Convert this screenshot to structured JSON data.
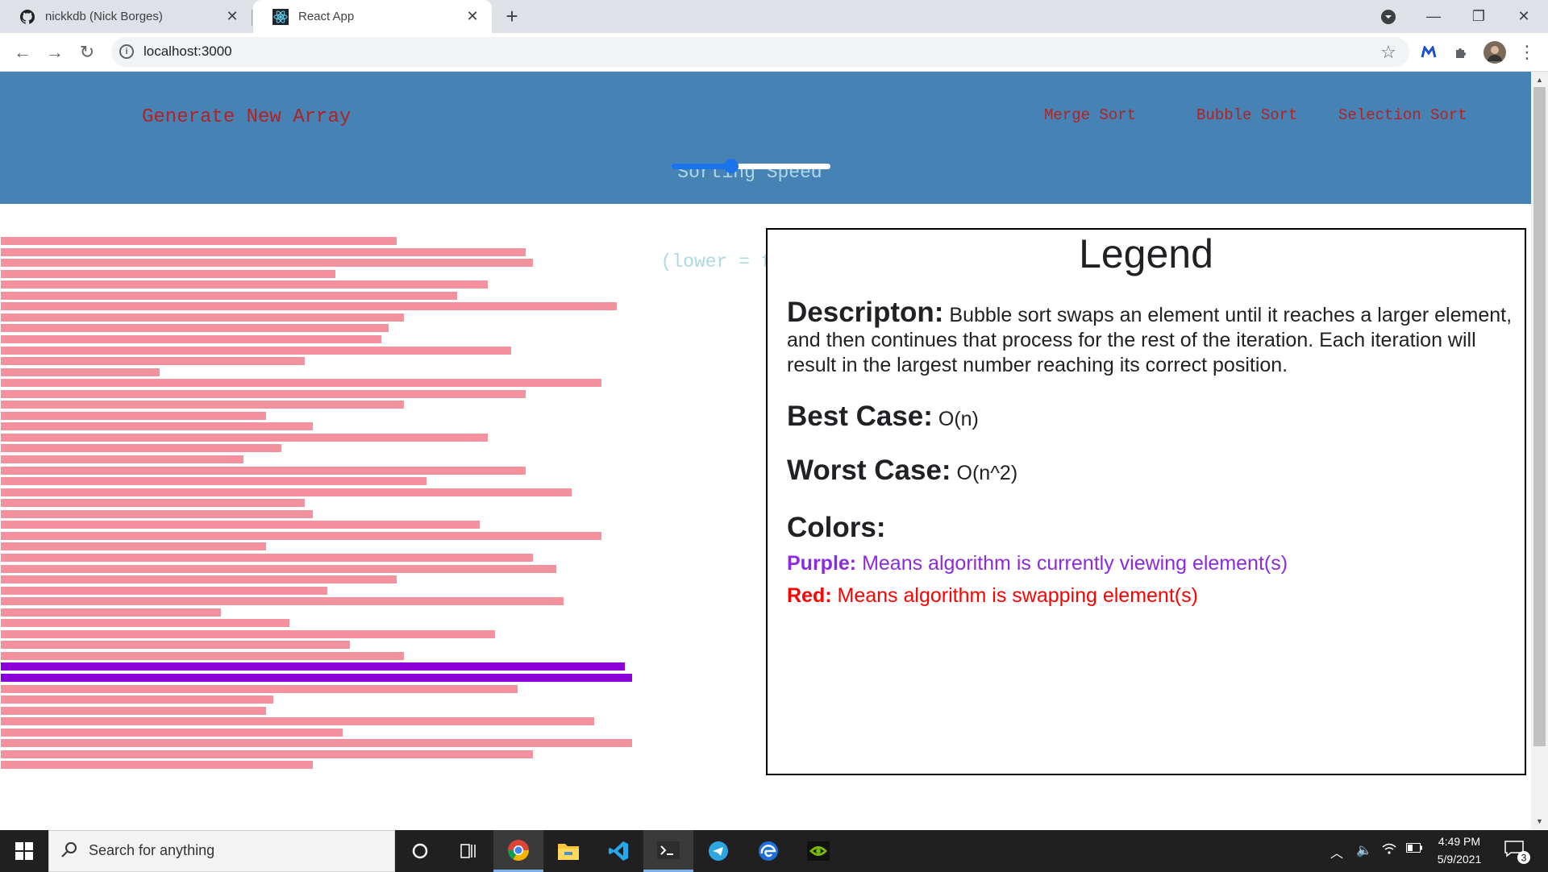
{
  "browser": {
    "tabs": [
      {
        "title": "nickkdb (Nick Borges)",
        "icon": "github-icon"
      },
      {
        "title": "React App",
        "icon": "react-icon",
        "active": true
      }
    ],
    "url": "localhost:3000"
  },
  "header": {
    "generate_label": "Generate New Array",
    "speed_title_1": "Sorting Speed",
    "speed_title_2": "(lower = faster)",
    "speed_value": 0.38,
    "algorithms": [
      "Merge Sort",
      "Bubble Sort",
      "Selection Sort"
    ]
  },
  "bars": {
    "colors": {
      "default": "#f4919e",
      "comparing": "#8b00d7"
    },
    "lengths": [
      491,
      651,
      660,
      415,
      604,
      566,
      764,
      500,
      481,
      472,
      633,
      377,
      197,
      745,
      651,
      500,
      329,
      387,
      604,
      348,
      301,
      651,
      528,
      708,
      377,
      387,
      594,
      745,
      329,
      660,
      689,
      491,
      405,
      698,
      273,
      358,
      613,
      433,
      500,
      774,
      783,
      641,
      338,
      329,
      736,
      424,
      783,
      660,
      387
    ],
    "comparing_indices": [
      39,
      40
    ]
  },
  "legend": {
    "title": "Legend",
    "description_label": "Descripton:",
    "description_text": "Bubble sort swaps an element until it reaches a larger element, and then continues that process for the rest of the iteration. Each iteration will result in the largest number reaching its correct position.",
    "best_label": "Best Case:",
    "best_value": "O(n)",
    "worst_label": "Worst Case:",
    "worst_value": "O(n^2)",
    "colors_label": "Colors:",
    "purple_label": "Purple:",
    "purple_text": "Means algorithm is currently viewing element(s)",
    "red_label": "Red:",
    "red_text": "Means algorithm is swapping element(s)",
    "purple_color": "#8a2be2",
    "red_color": "#ff0000"
  },
  "taskbar": {
    "search_placeholder": "Search for anything",
    "time": "4:49 PM",
    "date": "5/9/2021",
    "notification_count": "3",
    "apps": [
      "cortana-icon",
      "task-view-icon",
      "chrome-icon",
      "file-explorer-icon",
      "vscode-icon",
      "terminal-icon",
      "telegram-icon",
      "edge-icon",
      "nvidia-icon"
    ]
  }
}
